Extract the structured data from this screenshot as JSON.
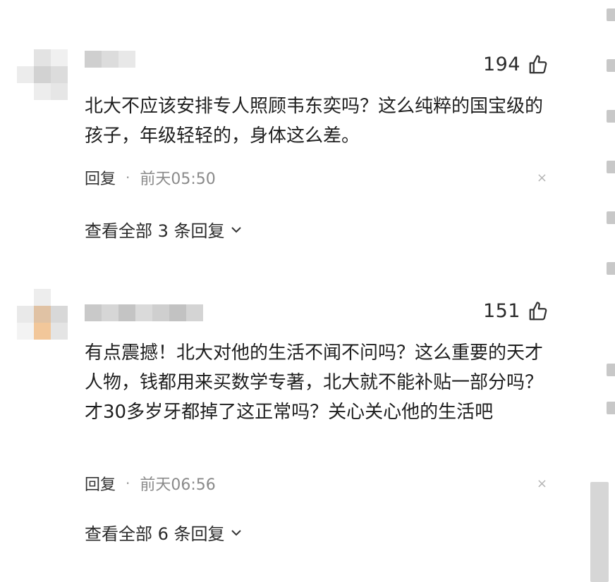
{
  "comments": [
    {
      "likes": "194",
      "text": "北大不应该安排专人照顾韦东奕吗？这么纯粹的国宝级的孩子，年级轻轻的，身体这么差。",
      "reply_label": "回复",
      "separator": "·",
      "time": "前天05:50",
      "close_glyph": "×",
      "view_all_label": "查看全部 3 条回复"
    },
    {
      "likes": "151",
      "text": "有点震撼！北大对他的生活不闻不问吗？这么重要的天才人物，钱都用来买数学专著，北大就不能补贴一部分吗？才30多岁牙都掉了这正常吗？关心关心他的生活吧",
      "reply_label": "回复",
      "separator": "·",
      "time": "前天06:56",
      "close_glyph": "×",
      "view_all_label": "查看全部 6 条回复"
    }
  ],
  "icons": {
    "like": "thumbs-up-icon",
    "close": "close-icon",
    "expand": "chevron-down-icon"
  },
  "colors": {
    "text": "#1f1f1f",
    "muted": "#8a8a8a",
    "avatar_blur_1": "#d9d9d9",
    "avatar_blur_2": "#f2c79a"
  }
}
